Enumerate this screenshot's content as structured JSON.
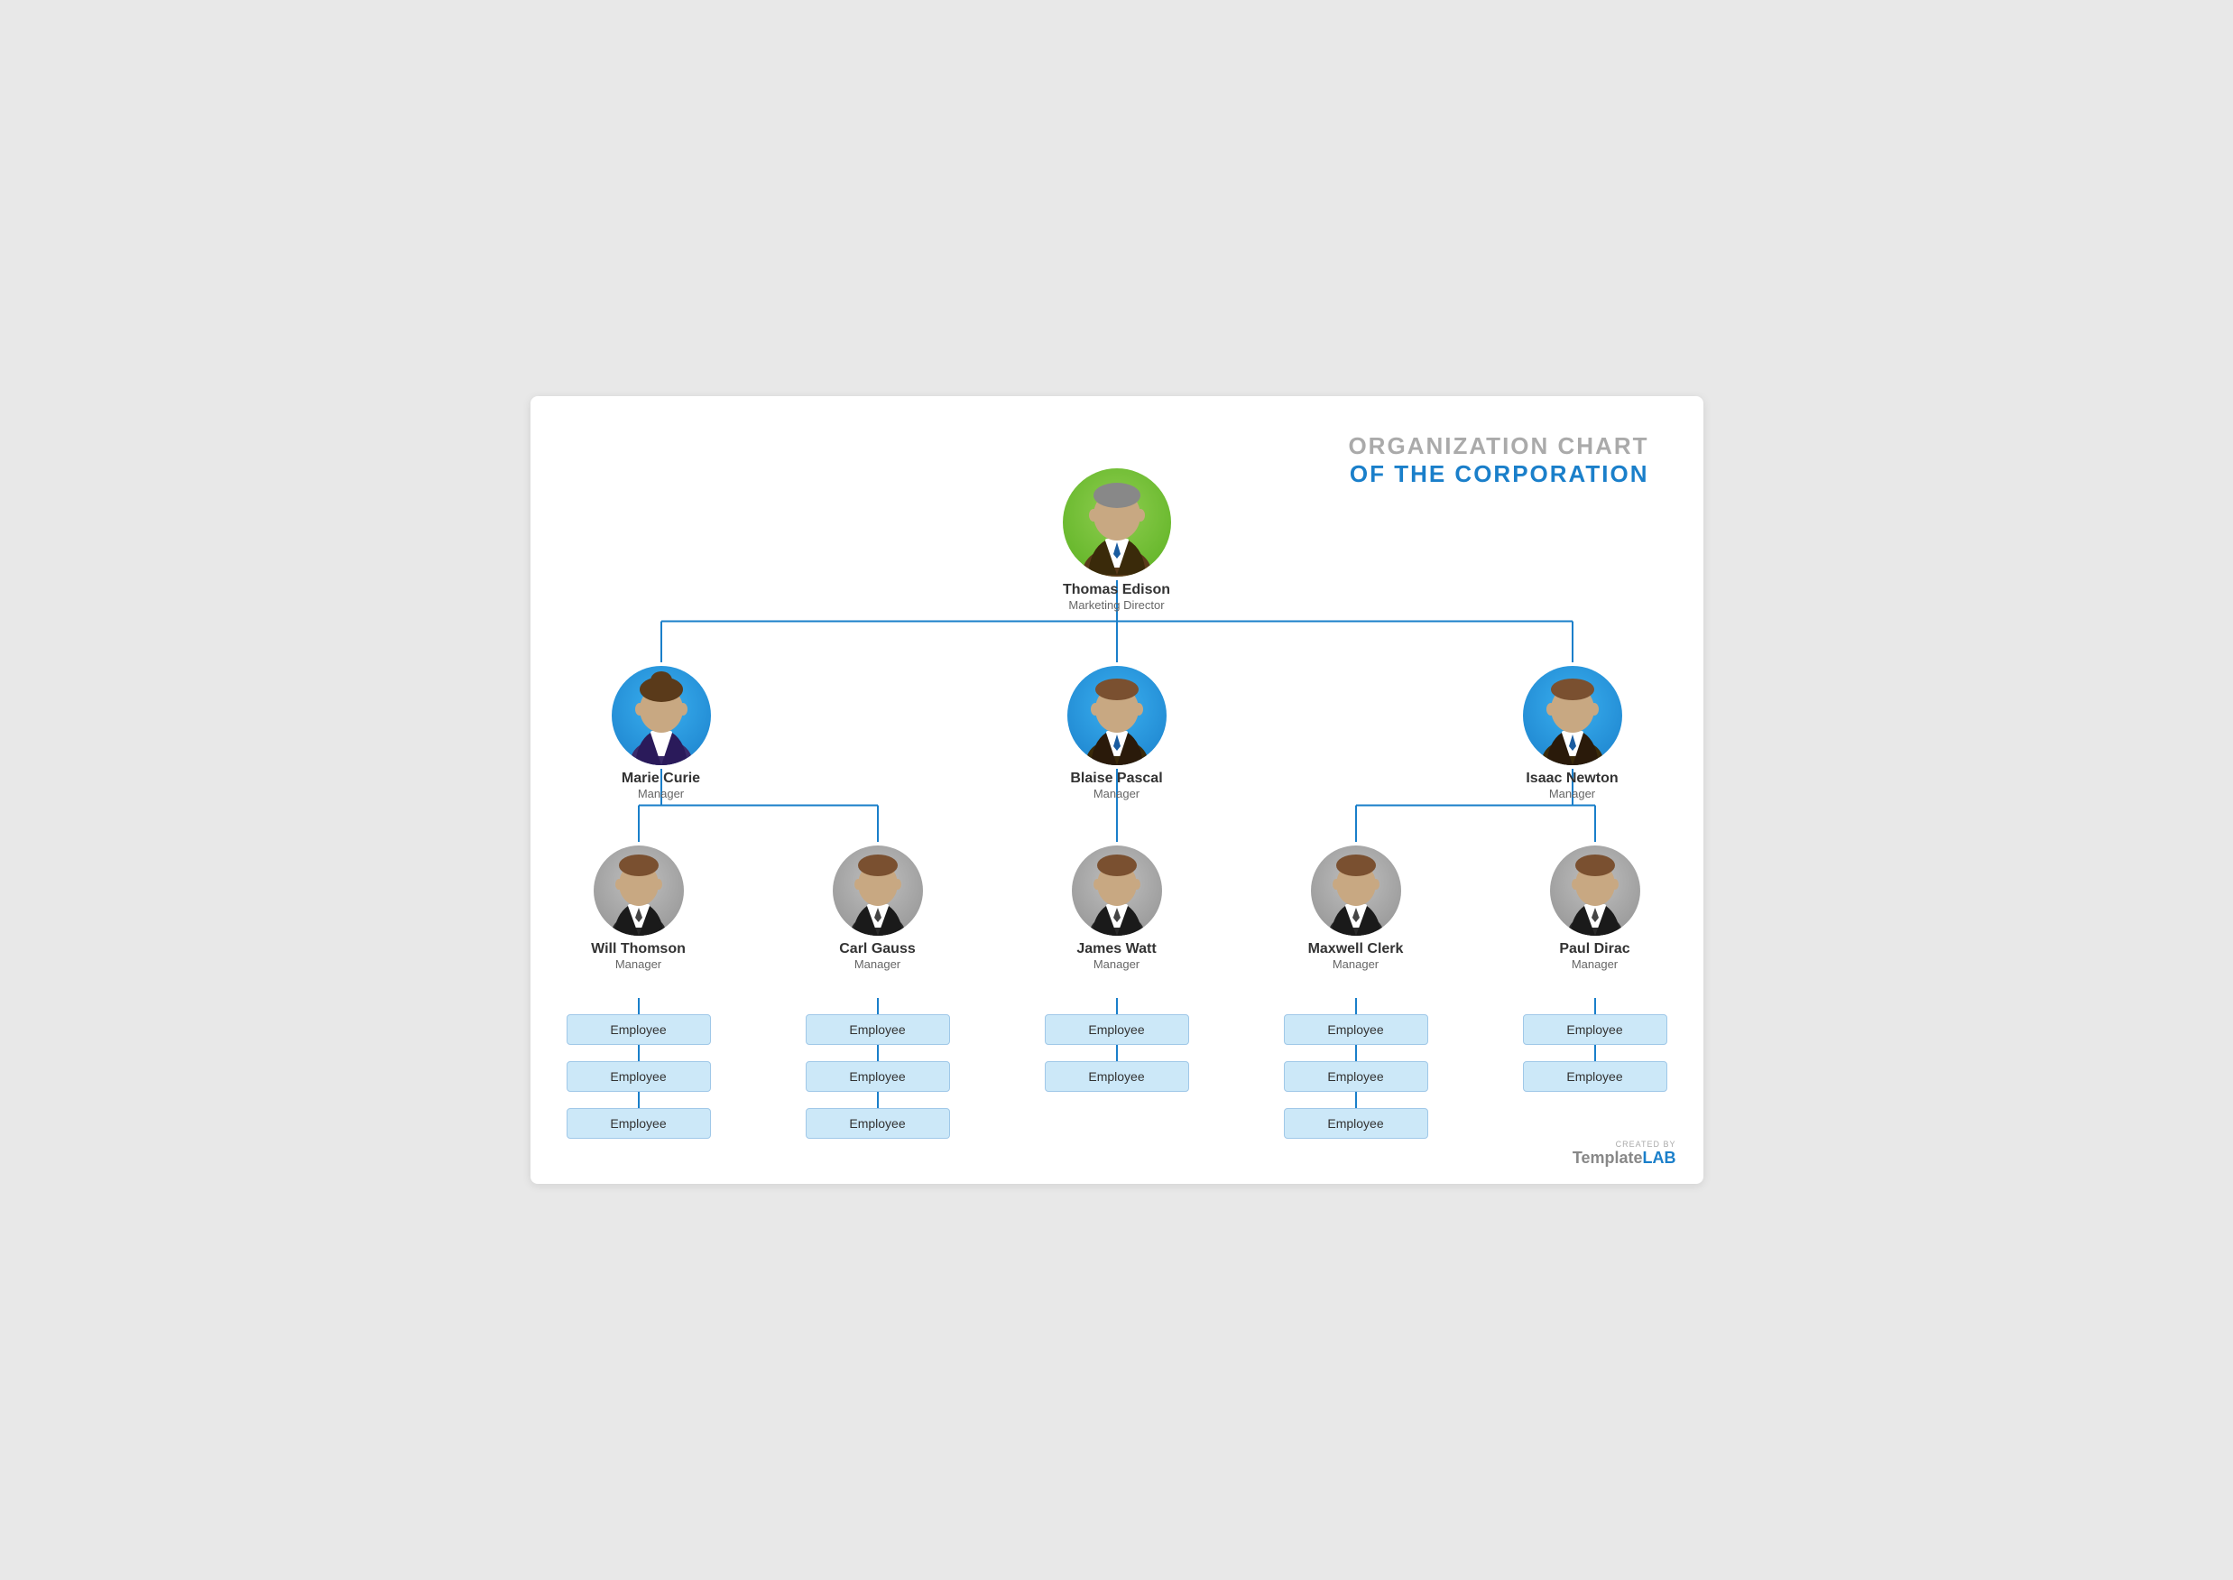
{
  "title": {
    "line1": "ORGANIZATION CHART",
    "line2": "OF THE CORPORATION"
  },
  "ceo": {
    "name": "Thomas Edison",
    "role": "Marketing Director",
    "avatarType": "green",
    "avatarSize": 120
  },
  "managers": [
    {
      "name": "Marie Curie",
      "role": "Manager",
      "avatarType": "blue",
      "avatarSize": 110,
      "isFemale": true
    },
    {
      "name": "Blaise Pascal",
      "role": "Manager",
      "avatarType": "blue",
      "avatarSize": 110,
      "isFemale": false
    },
    {
      "name": "Isaac Newton",
      "role": "Manager",
      "avatarType": "blue",
      "avatarSize": 110,
      "isFemale": false
    }
  ],
  "subManagers": [
    {
      "name": "Will Thomson",
      "role": "Manager",
      "avatarType": "gray",
      "avatarSize": 100,
      "parentIndex": 0,
      "employees": [
        "Employee",
        "Employee",
        "Employee"
      ]
    },
    {
      "name": "Carl Gauss",
      "role": "Manager",
      "avatarType": "gray",
      "avatarSize": 100,
      "parentIndex": 0,
      "employees": [
        "Employee",
        "Employee",
        "Employee"
      ]
    },
    {
      "name": "James Watt",
      "role": "Manager",
      "avatarType": "gray",
      "avatarSize": 100,
      "parentIndex": 1,
      "employees": [
        "Employee",
        "Employee"
      ]
    },
    {
      "name": "Maxwell Clerk",
      "role": "Manager",
      "avatarType": "gray",
      "avatarSize": 100,
      "parentIndex": 2,
      "employees": [
        "Employee",
        "Employee",
        "Employee"
      ]
    },
    {
      "name": "Paul Dirac",
      "role": "Manager",
      "avatarType": "gray",
      "avatarSize": 100,
      "parentIndex": 2,
      "employees": [
        "Employee",
        "Employee"
      ]
    }
  ],
  "templatelab": {
    "created": "CREATED BY",
    "template": "Template",
    "lab": "LAB"
  }
}
